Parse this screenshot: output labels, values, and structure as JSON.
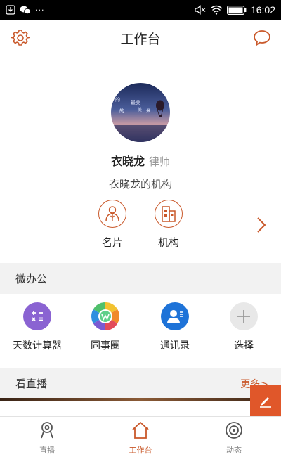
{
  "status_bar": {
    "time": "16:02",
    "dots": "···"
  },
  "header": {
    "title": "工作台"
  },
  "profile": {
    "name": "衣晓龙",
    "role": "律师",
    "org": "衣晓龙的机构",
    "avatar_text": [
      "的",
      "最美",
      "的",
      "美",
      "景"
    ]
  },
  "quick_actions": [
    {
      "label": "名片",
      "icon": "person-card-icon"
    },
    {
      "label": "机构",
      "icon": "building-icon"
    }
  ],
  "micro_office": {
    "title": "微办公",
    "apps": [
      {
        "label": "天数计算器",
        "icon": "calculator-icon",
        "color": "#8a63d2"
      },
      {
        "label": "同事圈",
        "icon": "colleague-circle-icon",
        "color": "#4fb86b"
      },
      {
        "label": "通讯录",
        "icon": "contacts-icon",
        "color": "#1e73d8"
      },
      {
        "label": "选择",
        "icon": "plus-icon",
        "color": "#e8e8e8"
      }
    ]
  },
  "live": {
    "title": "看直播",
    "more": "更多>"
  },
  "bottom_nav": [
    {
      "label": "直播",
      "icon": "live-icon",
      "active": false
    },
    {
      "label": "工作台",
      "icon": "home-icon",
      "active": true
    },
    {
      "label": "动态",
      "icon": "target-icon",
      "active": false
    }
  ],
  "colors": {
    "accent": "#c9582a",
    "fab": "#e0572a",
    "section_bg": "#f2f2f2"
  }
}
